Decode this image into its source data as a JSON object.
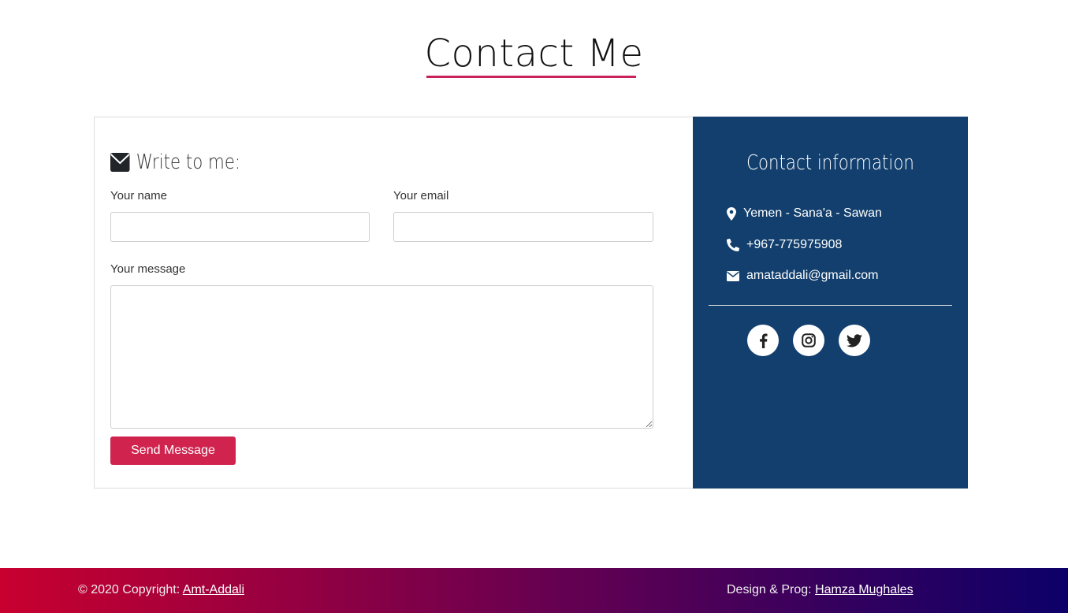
{
  "page": {
    "title": "Contact Me"
  },
  "form": {
    "heading": "Write to me:",
    "name_label": "Your name",
    "name_value": "",
    "email_label": "Your email",
    "email_value": "",
    "message_label": "Your message",
    "message_value": "",
    "send_label": "Send Message"
  },
  "info": {
    "title": "Contact information",
    "address": "Yemen - Sana'a - Sawan",
    "phone": "+967-775975908",
    "email": "amataddali@gmail.com",
    "social": [
      {
        "icon": "facebook-icon"
      },
      {
        "icon": "instagram-icon"
      },
      {
        "icon": "twitter-icon"
      }
    ]
  },
  "footer": {
    "copyright_prefix": "© 2020 Copyright: ",
    "copyright_link": "Amt-Addali",
    "credit_prefix": "Design & Prog: ",
    "credit_link": "Hamza Mughales"
  },
  "colors": {
    "accent": "#d0244f",
    "panel": "#123f6d",
    "footer_gradient_start": "#c8002f",
    "footer_gradient_end": "#0c0068"
  }
}
